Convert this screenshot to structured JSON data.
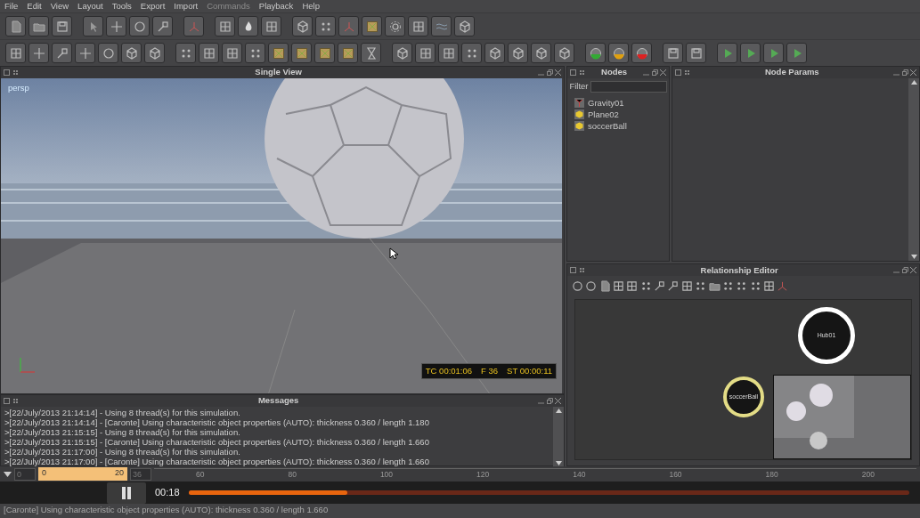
{
  "menu": [
    {
      "label": "File",
      "disabled": false
    },
    {
      "label": "Edit",
      "disabled": false
    },
    {
      "label": "View",
      "disabled": false
    },
    {
      "label": "Layout",
      "disabled": false
    },
    {
      "label": "Tools",
      "disabled": false
    },
    {
      "label": "Export",
      "disabled": false
    },
    {
      "label": "Import",
      "disabled": false
    },
    {
      "label": "Commands",
      "disabled": true
    },
    {
      "label": "Playback",
      "disabled": false
    },
    {
      "label": "Help",
      "disabled": false
    }
  ],
  "viewport": {
    "title": "Single View",
    "camera": "persp",
    "timecode": "TC 00:01:06",
    "frame": "F 36",
    "sim_time": "ST 00:00:11"
  },
  "nodes": {
    "title": "Nodes",
    "filter_label": "Filter",
    "items": [
      {
        "label": "Gravity01",
        "kind": "daemon"
      },
      {
        "label": "Plane02",
        "kind": "object"
      },
      {
        "label": "soccerBall",
        "kind": "object"
      }
    ]
  },
  "node_params": {
    "title": "Node Params"
  },
  "relationship_editor": {
    "title": "Relationship Editor",
    "nodes": [
      {
        "label": "Hub01",
        "color": "#ffffff"
      },
      {
        "label": "soccerBall",
        "color": "#e3dc86"
      }
    ]
  },
  "messages": {
    "title": "Messages",
    "lines": [
      ">[22/July/2013 21:14:14] - Using 8 thread(s) for this simulation.",
      ">[22/July/2013 21:14:14] - [Caronte] Using characteristic object properties (AUTO): thickness 0.360 / length 1.180",
      ">[22/July/2013 21:15:15] - Using 8 thread(s) for this simulation.",
      ">[22/July/2013 21:15:15] - [Caronte] Using characteristic object properties (AUTO): thickness 0.360 / length 1.660",
      ">[22/July/2013 21:17:00] - Using 8 thread(s) for this simulation.",
      ">[22/July/2013 21:17:00] - [Caronte] Using characteristic object properties (AUTO): thickness 0.360 / length 1.660"
    ]
  },
  "timeline": {
    "start": "0",
    "range_start": "0",
    "range_mark": "20",
    "end": "36",
    "ticks": [
      "60",
      "80",
      "100",
      "120",
      "140",
      "160",
      "180",
      "200"
    ]
  },
  "player": {
    "time": "00:18",
    "level": 0.22
  },
  "status_bar": "[Caronte] Using characteristic object properties (AUTO): thickness 0.360 / length 1.660"
}
